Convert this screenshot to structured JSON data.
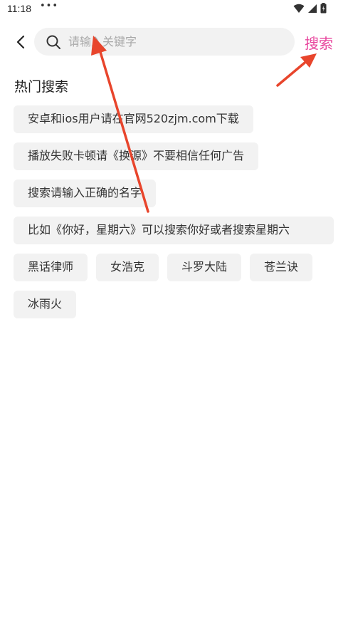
{
  "status_bar": {
    "time": "11:18",
    "dots": "•••"
  },
  "search": {
    "placeholder": "请输入关键字",
    "value": "",
    "submit_label": "搜索"
  },
  "hot_search": {
    "title": "热门搜索",
    "tags": [
      "安卓和ios用户请在官网520zjm.com下载",
      "播放失败卡顿请《换源》不要相信任何广告",
      "搜索请输入正确的名字",
      "比如《你好，星期六》可以搜索你好或者搜索星期六",
      "黑话律师",
      "女浩克",
      "斗罗大陆",
      "苍兰诀",
      "冰雨火"
    ]
  },
  "colors": {
    "accent": "#e8459d",
    "annotation_arrow": "#e8452c",
    "tag_bg": "#f2f2f2"
  },
  "icons": {
    "back": "chevron-left-icon",
    "search": "search-icon",
    "wifi": "wifi-icon",
    "signal": "signal-icon",
    "battery": "battery-icon"
  }
}
